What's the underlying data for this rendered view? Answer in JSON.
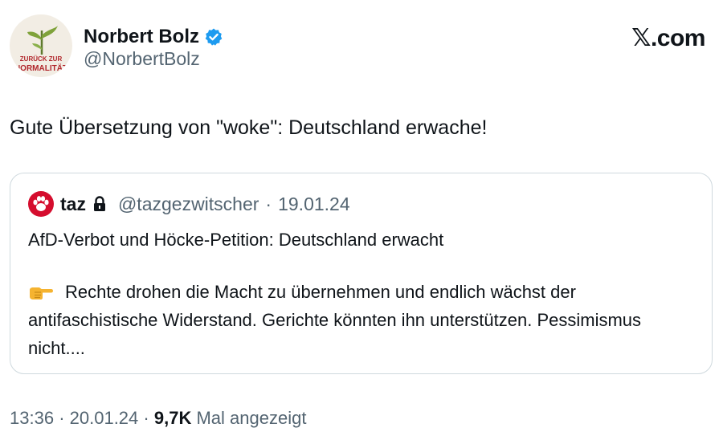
{
  "author": {
    "name": "Norbert Bolz",
    "handle": "@NorbertBolz",
    "verified": true,
    "avatar_text_1": "ZURÜCK ZUR",
    "avatar_text_2": "NORMALITÄT"
  },
  "brand": "𝕏.com",
  "tweet_text": "Gute Übersetzung von \"woke\": Deutschland erwache!",
  "quote": {
    "name": "taz",
    "handle": "@tazgezwitscher",
    "separator": "·",
    "date": "19.01.24",
    "headline": "AfD-Verbot und Höcke-Petition: Deutschland erwacht",
    "body": "Rechte drohen die Macht zu übernehmen und endlich wächst der antifaschistische Widerstand. Gerichte könnten ihn unterstützen. Pessimismus nicht...."
  },
  "meta": {
    "time": "13:36",
    "separator": "·",
    "date": "20.01.24",
    "views": "9,7K",
    "views_label": "Mal angezeigt"
  },
  "colors": {
    "verified": "#1d9bf0",
    "taz_red": "#d50d2e",
    "secondary_text": "#536471",
    "card_border": "#cfd9de"
  }
}
